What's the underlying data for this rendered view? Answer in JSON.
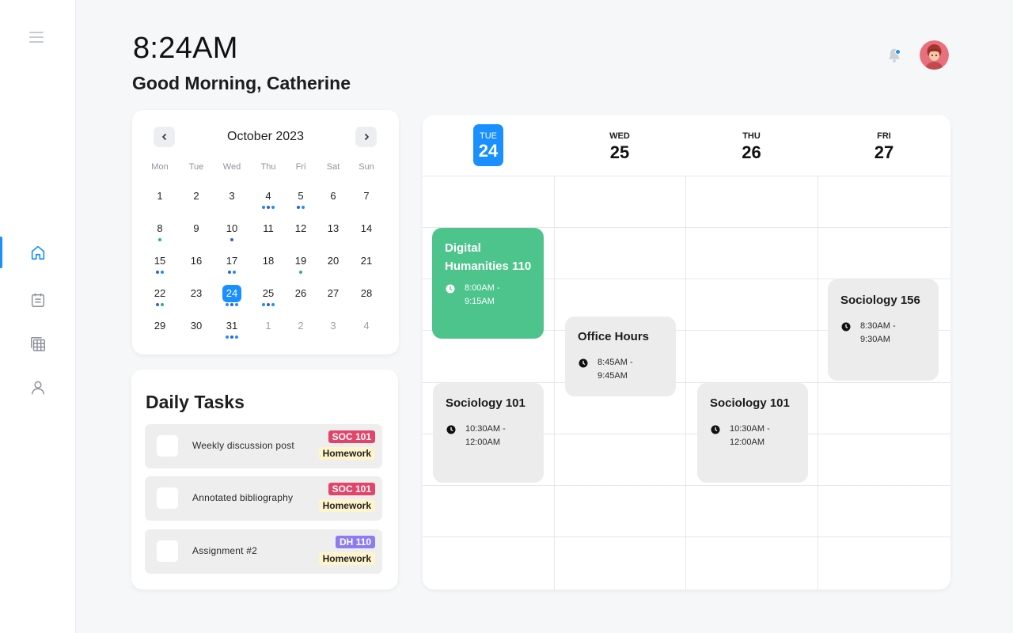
{
  "header": {
    "time": "8:24AM",
    "greeting": "Good Morning, Catherine"
  },
  "calendar": {
    "title": "October 2023",
    "weekdays": [
      "Mon",
      "Tue",
      "Wed",
      "Thu",
      "Fri",
      "Sat",
      "Sun"
    ],
    "weeks": [
      [
        {
          "n": "1",
          "dots": []
        },
        {
          "n": "2",
          "dots": []
        },
        {
          "n": "3",
          "dots": []
        },
        {
          "n": "4",
          "dots": [
            "#1a8fff",
            "#3b5bdb",
            "#1a8fff"
          ]
        },
        {
          "n": "5",
          "dots": [
            "#3b5bdb",
            "#1a8fff"
          ]
        },
        {
          "n": "6",
          "dots": []
        },
        {
          "n": "7",
          "dots": []
        }
      ],
      [
        {
          "n": "8",
          "dots": [
            "#2fb374"
          ]
        },
        {
          "n": "9",
          "dots": []
        },
        {
          "n": "10",
          "dots": [
            "#3b5bdb"
          ]
        },
        {
          "n": "11",
          "dots": []
        },
        {
          "n": "12",
          "dots": []
        },
        {
          "n": "13",
          "dots": []
        },
        {
          "n": "14",
          "dots": []
        }
      ],
      [
        {
          "n": "15",
          "dots": [
            "#3b5bdb",
            "#1a8fff"
          ]
        },
        {
          "n": "16",
          "dots": []
        },
        {
          "n": "17",
          "dots": [
            "#3b5bdb",
            "#1a8fff"
          ]
        },
        {
          "n": "18",
          "dots": []
        },
        {
          "n": "19",
          "dots": [
            "#2fb374"
          ]
        },
        {
          "n": "20",
          "dots": []
        },
        {
          "n": "21",
          "dots": []
        }
      ],
      [
        {
          "n": "22",
          "dots": [
            "#3b5bdb",
            "#2fb374"
          ]
        },
        {
          "n": "23",
          "dots": []
        },
        {
          "n": "24",
          "dots": [
            "#1a8fff",
            "#3b5bdb",
            "#1a8fff"
          ],
          "selected": true
        },
        {
          "n": "25",
          "dots": [
            "#1a8fff",
            "#3b5bdb",
            "#1a8fff"
          ]
        },
        {
          "n": "26",
          "dots": []
        },
        {
          "n": "27",
          "dots": []
        },
        {
          "n": "28",
          "dots": []
        }
      ],
      [
        {
          "n": "29",
          "dots": []
        },
        {
          "n": "30",
          "dots": []
        },
        {
          "n": "31",
          "dots": [
            "#1a8fff",
            "#3b5bdb",
            "#1a8fff"
          ]
        },
        {
          "n": "1",
          "dots": [],
          "muted": true
        },
        {
          "n": "2",
          "dots": [],
          "muted": true
        },
        {
          "n": "3",
          "dots": [],
          "muted": true
        },
        {
          "n": "4",
          "dots": [],
          "muted": true
        }
      ]
    ]
  },
  "tasks": {
    "title": "Daily Tasks",
    "items": [
      {
        "label": "Weekly discussion post",
        "course": "SOC 101",
        "course_color": "#e2456a",
        "type": "Homework"
      },
      {
        "label": "Annotated bibliography",
        "course": "SOC 101",
        "course_color": "#e2456a",
        "type": "Homework"
      },
      {
        "label": "Assignment #2",
        "course": "DH 110",
        "course_color": "#8c7cf0",
        "type": "Homework"
      }
    ]
  },
  "week": {
    "days": [
      {
        "weekday": "TUE",
        "date": "24",
        "today": true
      },
      {
        "weekday": "WED",
        "date": "25"
      },
      {
        "weekday": "THU",
        "date": "26"
      },
      {
        "weekday": "FRI",
        "date": "27"
      }
    ],
    "events": [
      {
        "title": "Digital Humanities 110",
        "time": "8:00AM - 9:15AM",
        "color": "green"
      },
      {
        "title": "Office Hours",
        "time": "8:45AM - 9:45AM",
        "color": "gray"
      },
      {
        "title": "Sociology 156",
        "time": "8:30AM - 9:30AM",
        "color": "gray"
      },
      {
        "title": "Sociology 101",
        "time": "10:30AM - 12:00AM",
        "color": "gray"
      },
      {
        "title": "Sociology 101",
        "time": "10:30AM - 12:00AM",
        "color": "gray"
      }
    ]
  },
  "icons": {
    "menu": "hamburger-menu-icon",
    "nav": [
      "home-icon",
      "calendar-icon",
      "schedule-grid-icon",
      "user-icon"
    ],
    "notifications": "bell-icon",
    "clock": "clock-icon"
  },
  "colors": {
    "accent": "#1a8fff",
    "event_green": "#4cc48c",
    "event_gray": "#ececec"
  }
}
